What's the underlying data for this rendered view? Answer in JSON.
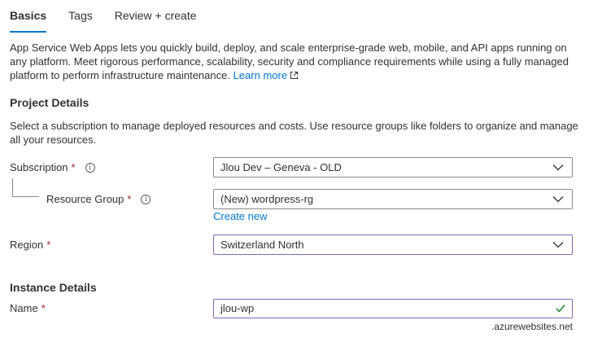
{
  "tabs": [
    {
      "label": "Basics",
      "active": true
    },
    {
      "label": "Tags",
      "active": false
    },
    {
      "label": "Review + create",
      "active": false
    }
  ],
  "description": {
    "text": "App Service Web Apps lets you quickly build, deploy, and scale enterprise-grade web, mobile, and API apps running on any platform. Meet rigorous performance, scalability, security and compliance requirements while using a fully managed platform to perform infrastructure maintenance.",
    "learn_more": "Learn more"
  },
  "project_details": {
    "title": "Project Details",
    "text": "Select a subscription to manage deployed resources and costs. Use resource groups like folders to organize and manage all your resources."
  },
  "fields": {
    "subscription": {
      "label": "Subscription",
      "value": "Jlou Dev – Geneva - OLD"
    },
    "resource_group": {
      "label": "Resource Group",
      "value": "(New) wordpress-rg",
      "create_new": "Create new"
    },
    "region": {
      "label": "Region",
      "value": "Switzerland North"
    }
  },
  "instance_details": {
    "title": "Instance Details",
    "name_label": "Name",
    "name_value": "jlou-wp",
    "suffix": ".azurewebsites.net"
  },
  "required_marker": "*",
  "info_glyph": "i",
  "colors": {
    "accent": "#0078d4",
    "required": "#a4262c",
    "focus": "#8764b8",
    "valid": "#107c10"
  }
}
